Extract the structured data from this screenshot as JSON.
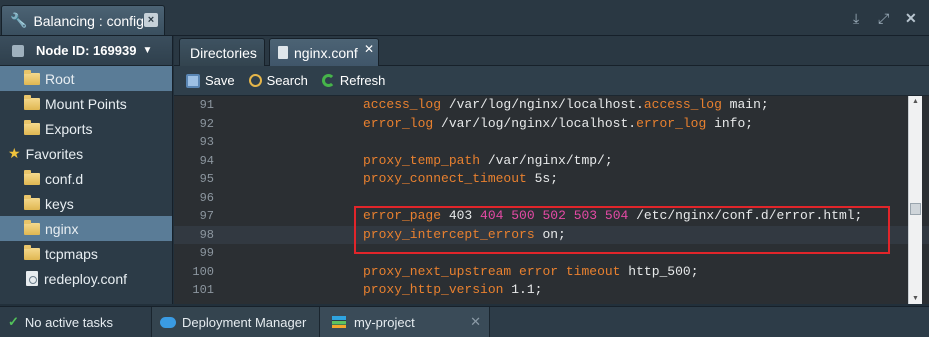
{
  "window": {
    "title": "Balancing : configs",
    "close_label": "×",
    "controls": {
      "download": "⤓",
      "expand": "⤢",
      "close": "✕"
    }
  },
  "sidebar": {
    "node_label": "Node ID: 169939",
    "root_items": [
      {
        "label": "Root",
        "selected": true
      },
      {
        "label": "Mount Points",
        "selected": false
      },
      {
        "label": "Exports",
        "selected": false
      }
    ],
    "favorites_label": "Favorites",
    "favorites": [
      {
        "label": "conf.d",
        "type": "folder",
        "selected": false
      },
      {
        "label": "keys",
        "type": "folder",
        "selected": false
      },
      {
        "label": "nginx",
        "type": "folder",
        "selected": true
      },
      {
        "label": "tcpmaps",
        "type": "folder",
        "selected": false
      },
      {
        "label": "redeploy.conf",
        "type": "file",
        "selected": false
      }
    ]
  },
  "editor": {
    "tabs": [
      {
        "label": "Directories",
        "active": false
      },
      {
        "label": "nginx.conf",
        "active": true,
        "close": "✕"
      }
    ],
    "toolbar": {
      "save": "Save",
      "search": "Search",
      "refresh": "Refresh"
    },
    "lines": [
      {
        "num": "91",
        "text": "access_log /var/log/nginx/localhost.access_log main;"
      },
      {
        "num": "92",
        "text": "error_log /var/log/nginx/localhost.error_log info;"
      },
      {
        "num": "93",
        "text": ""
      },
      {
        "num": "94",
        "text": "proxy_temp_path /var/nginx/tmp/;"
      },
      {
        "num": "95",
        "text": "proxy_connect_timeout 5s;"
      },
      {
        "num": "96",
        "text": ""
      },
      {
        "num": "97",
        "text": "error_page 403 404 500 502 503 504 /etc/nginx/conf.d/error.html;"
      },
      {
        "num": "98",
        "text": "proxy_intercept_errors on;"
      },
      {
        "num": "99",
        "text": ""
      },
      {
        "num": "100",
        "text": "proxy_next_upstream error timeout http_500;"
      },
      {
        "num": "101",
        "text": "proxy_http_version 1.1;"
      }
    ],
    "active_line": "98"
  },
  "statusbar": {
    "tasks": "No active tasks",
    "deployment_manager": "Deployment Manager",
    "project": "my-project",
    "project_close": "✕"
  },
  "colors": {
    "keyword": "#e8802f",
    "number": "#e44aa5",
    "highlight_box": "#e1252a",
    "selection": "#5a7c97"
  }
}
